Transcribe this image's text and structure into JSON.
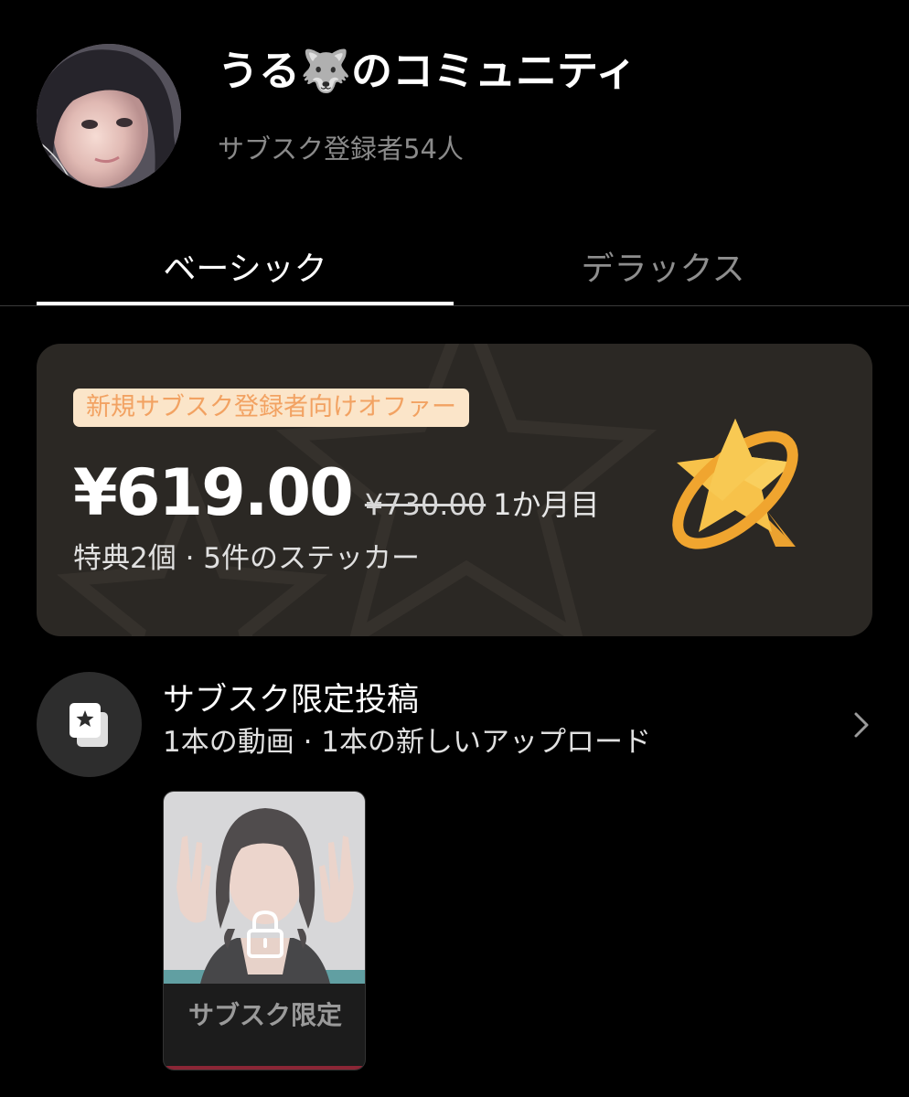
{
  "header": {
    "title": "うる🐺のコミュニティ",
    "subscriber_text": "サブスク登録者54人"
  },
  "tabs": [
    {
      "label": "ベーシック",
      "selected": true
    },
    {
      "label": "デラックス",
      "selected": false
    }
  ],
  "offer": {
    "badge": "新規サブスク登録者向けオファー",
    "price": "¥619.00",
    "original_price": "¥730.00",
    "period": "1か月目",
    "benefits": "特典2個 · 5件のステッカー",
    "icon": "star-orbit-icon"
  },
  "exclusive_posts": {
    "icon": "exclusive-posts-icon",
    "title": "サブスク限定投稿",
    "subtitle": "1本の動画 · 1本の新しいアップロード",
    "chevron_icon": "chevron-right-icon",
    "thumbnail": {
      "label": "サブスク限定",
      "lock_icon": "lock-icon"
    }
  },
  "colors": {
    "background": "#000000",
    "card": "#2b2824",
    "badge_bg": "#fbe5c9",
    "badge_text": "#f2a262",
    "star": "#f5b83a",
    "muted_text": "#8a8a8a"
  }
}
